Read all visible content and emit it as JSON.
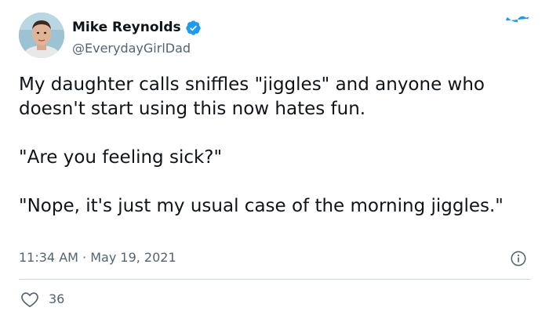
{
  "author": {
    "display_name": "Mike Reynolds",
    "handle": "@EverydayGirlDad",
    "verified": true,
    "avatar_icon": "profile-photo"
  },
  "brand": {
    "logo_icon": "twitter-bird-icon",
    "color": "#1d9bf0"
  },
  "tweet": {
    "paragraphs": [
      "My daughter calls sniffles \"jiggles\" and anyone who doesn't start using this now hates fun.",
      "\"Are you feeling sick?\"",
      "\"Nope, it's just my usual case of the morning jiggles.\""
    ],
    "time": "11:34 AM",
    "separator": "·",
    "date": "May 19, 2021"
  },
  "engagement": {
    "likes": "36"
  },
  "colors": {
    "text_primary": "#0f1419",
    "text_secondary": "#536471",
    "divider": "#cfd9de",
    "verified_badge": "#1d9bf0"
  }
}
